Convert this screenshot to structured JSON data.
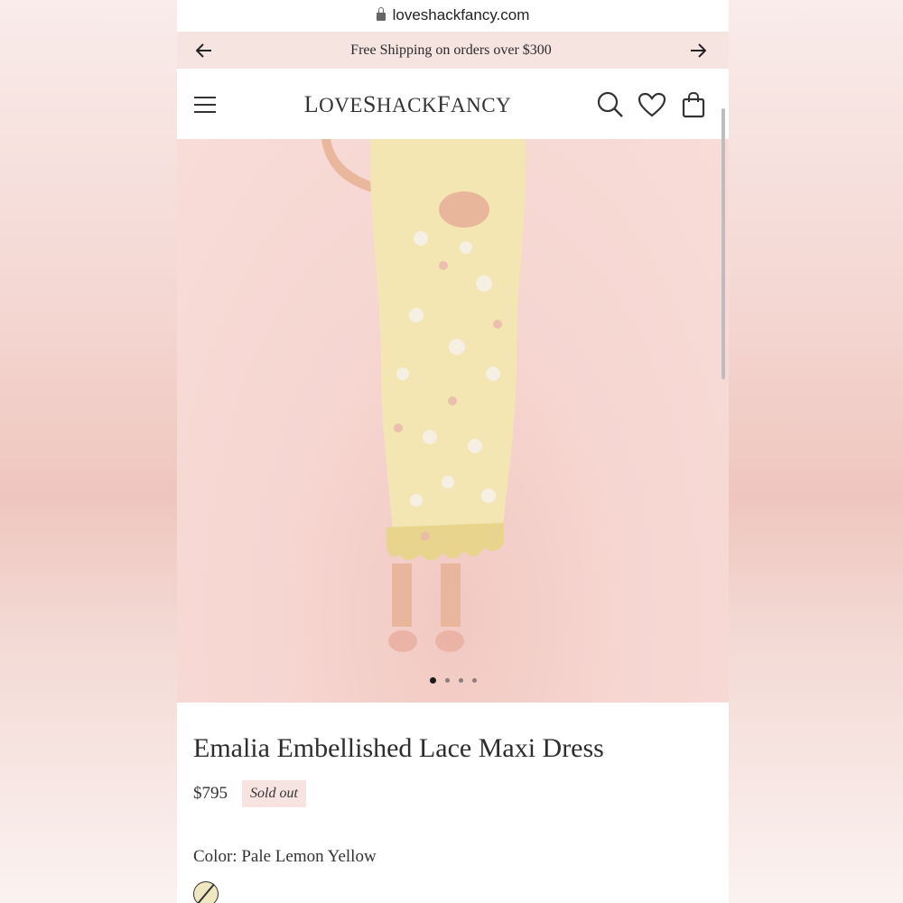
{
  "browser": {
    "url": "loveshackfancy.com"
  },
  "promo": {
    "text": "Free Shipping on orders over $300"
  },
  "header": {
    "logo_parts": [
      "L",
      "OVE",
      "S",
      "HACK",
      "F",
      "ANCY"
    ]
  },
  "carousel": {
    "slides": 4,
    "active_slide": 1
  },
  "product": {
    "title": "Emalia Embellished Lace Maxi Dress",
    "price": "$795",
    "status": "Sold out",
    "color_label": "Color:",
    "color_value": "Pale Lemon Yellow"
  },
  "colors": {
    "promo_bg": "#f6e4e1",
    "badge_bg": "#f7e3e0",
    "swatch": "#efe7bf"
  }
}
